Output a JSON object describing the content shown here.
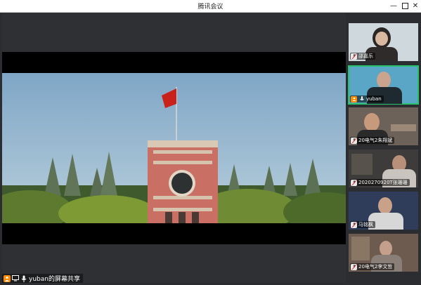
{
  "window": {
    "title": "腾讯会议"
  },
  "share": {
    "label": "yuban的屏幕共享"
  },
  "participants": [
    {
      "name": "邵嘉乐"
    },
    {
      "name": "yuban"
    },
    {
      "name": "20电气2朱翔斌"
    },
    {
      "name": "2020270920T张珊珊"
    },
    {
      "name": "马铭枫"
    },
    {
      "name": "20电气2李文哲"
    }
  ]
}
